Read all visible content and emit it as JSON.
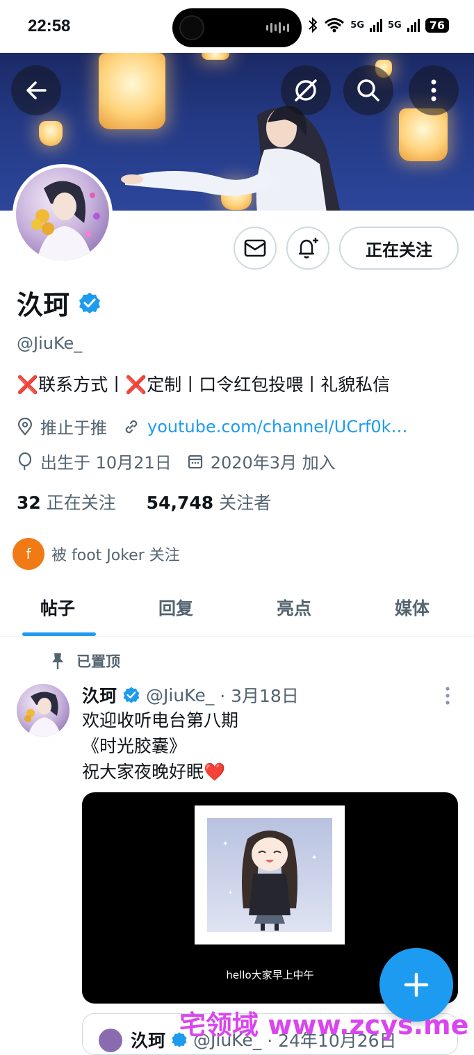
{
  "status": {
    "time": "22:58",
    "signal1": "5G",
    "signal2": "5G",
    "battery": "76"
  },
  "header": {
    "back_icon": "arrow-left-icon",
    "grok_icon": "slash-circle-icon",
    "search_icon": "search-icon",
    "more_icon": "more-vertical-icon"
  },
  "actions": {
    "follow_label": "正在关注"
  },
  "profile": {
    "name": "汣珂",
    "handle": "@JiuKe_",
    "bio": "❌联系方式丨❌定制丨口令红包投喂丨礼貌私信",
    "location": "推止于推",
    "link": "youtube.com/channel/UCrf0k…",
    "birthday": "出生于 10月21日",
    "joined": "2020年3月 加入"
  },
  "stats": {
    "following_count": "32",
    "following_label": "正在关注",
    "followers_count": "54,748",
    "followers_label": "关注者"
  },
  "followed_by": {
    "avatar_letter": "f",
    "text": "被 foot Joker 关注"
  },
  "tabs": [
    {
      "label": "帖子"
    },
    {
      "label": "回复"
    },
    {
      "label": "亮点"
    },
    {
      "label": "媒体"
    }
  ],
  "pinned_label": "已置顶",
  "post": {
    "name": "汣珂",
    "handle": "@JiuKe_",
    "date": "· 3月18日",
    "line1": "欢迎收听电台第八期",
    "line2": "《时光胶囊》",
    "line3": "祝大家夜晚好眠❤️",
    "media_caption": "hello大家早上中午"
  },
  "next_post": {
    "name": "汣珂",
    "handle": "@JiuKe_",
    "date": "· 24年10月26日"
  },
  "watermark": "宅领域 www.zcys.me",
  "colors": {
    "accent": "#1d9bf0",
    "text": "#0f1419",
    "muted": "#536471",
    "watermark": "#d946ef"
  }
}
